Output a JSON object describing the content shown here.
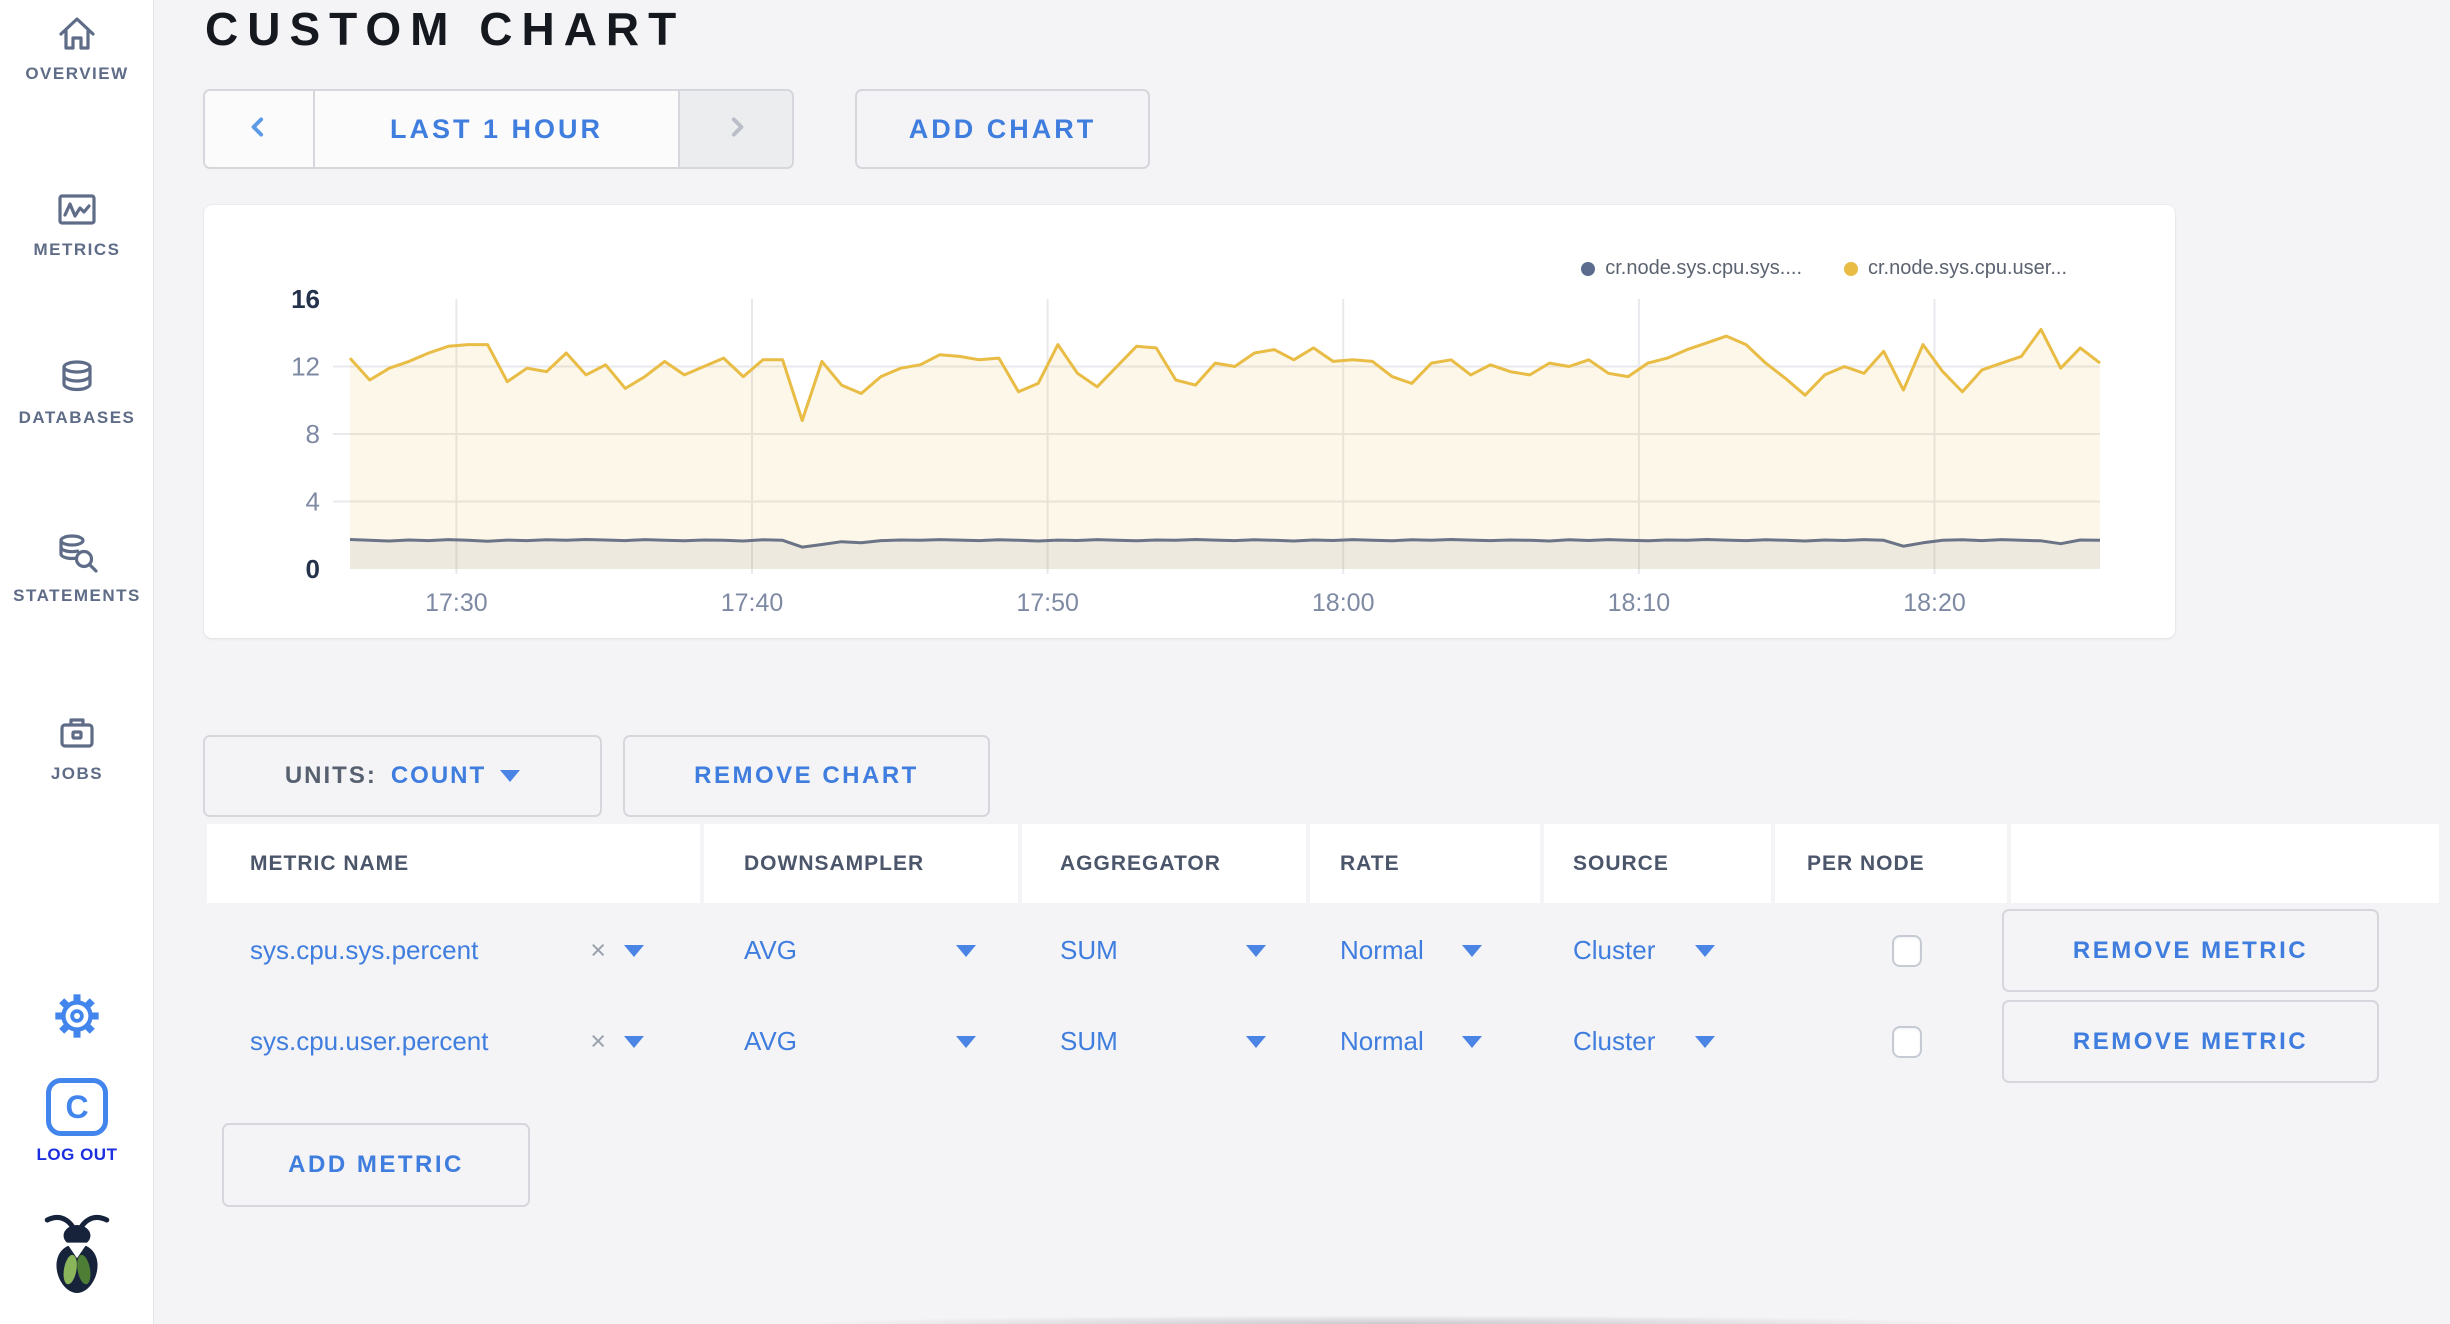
{
  "header": {
    "title": "CUSTOM CHART"
  },
  "toolbar": {
    "time_range_label": "LAST 1 HOUR",
    "add_chart_label": "ADD CHART"
  },
  "sidebar": {
    "items": [
      {
        "label": "OVERVIEW",
        "icon": "home-icon"
      },
      {
        "label": "METRICS",
        "icon": "metrics-icon"
      },
      {
        "label": "DATABASES",
        "icon": "databases-icon"
      },
      {
        "label": "STATEMENTS",
        "icon": "statements-icon"
      },
      {
        "label": "JOBS",
        "icon": "jobs-icon"
      }
    ],
    "logout_label": "LOG OUT",
    "logo_letter": "C"
  },
  "chart_controls": {
    "units_label": "UNITS:",
    "units_value": "COUNT",
    "remove_chart_label": "REMOVE CHART",
    "add_metric_label": "ADD METRIC"
  },
  "metrics_table": {
    "headers": [
      "METRIC NAME",
      "DOWNSAMPLER",
      "AGGREGATOR",
      "RATE",
      "SOURCE",
      "PER NODE",
      ""
    ],
    "rows": [
      {
        "metric_name": "sys.cpu.sys.percent",
        "clear": "×",
        "downsampler": "AVG",
        "aggregator": "SUM",
        "rate": "Normal",
        "source": "Cluster",
        "per_node_checked": false,
        "remove_label": "REMOVE METRIC"
      },
      {
        "metric_name": "sys.cpu.user.percent",
        "clear": "×",
        "downsampler": "AVG",
        "aggregator": "SUM",
        "rate": "Normal",
        "source": "Cluster",
        "per_node_checked": false,
        "remove_label": "REMOVE METRIC"
      }
    ]
  },
  "chart_data": {
    "type": "line",
    "title": "",
    "xlabel": "",
    "ylabel": "",
    "ylim": [
      0,
      16
    ],
    "y_ticks": [
      0,
      4,
      8,
      12,
      16
    ],
    "x_ticks": [
      "17:30",
      "17:40",
      "17:50",
      "18:00",
      "18:10",
      "18:20"
    ],
    "x_tick_minutes": [
      1050,
      1060,
      1070,
      1080,
      1090,
      1100
    ],
    "x_domain_minutes": [
      1046.4,
      1105.6
    ],
    "grid": true,
    "legend_position": "top-right",
    "colors": {
      "grid": "#E8E9EC",
      "axis_label": "#7E89A3",
      "axis_emphasis": "#24324B"
    },
    "series": [
      {
        "id": "sys",
        "name": "cr.node.sys.cpu.sys....",
        "color": "#6B7486",
        "fill": "rgba(107,116,134,0.10)",
        "values": [
          1.75,
          1.7,
          1.66,
          1.72,
          1.68,
          1.74,
          1.7,
          1.65,
          1.71,
          1.68,
          1.73,
          1.7,
          1.75,
          1.72,
          1.68,
          1.74,
          1.7,
          1.67,
          1.72,
          1.7,
          1.66,
          1.73,
          1.7,
          1.3,
          1.45,
          1.62,
          1.55,
          1.68,
          1.72,
          1.7,
          1.74,
          1.71,
          1.68,
          1.73,
          1.7,
          1.66,
          1.71,
          1.69,
          1.74,
          1.7,
          1.67,
          1.72,
          1.7,
          1.75,
          1.71,
          1.68,
          1.73,
          1.7,
          1.66,
          1.72,
          1.69,
          1.74,
          1.7,
          1.67,
          1.73,
          1.7,
          1.75,
          1.71,
          1.68,
          1.72,
          1.7,
          1.66,
          1.73,
          1.69,
          1.74,
          1.7,
          1.67,
          1.72,
          1.7,
          1.75,
          1.71,
          1.68,
          1.73,
          1.7,
          1.66,
          1.72,
          1.69,
          1.74,
          1.7,
          1.35,
          1.55,
          1.7,
          1.73,
          1.68,
          1.74,
          1.7,
          1.67,
          1.5,
          1.72,
          1.7
        ]
      },
      {
        "id": "user",
        "name": "cr.node.sys.cpu.user...",
        "color": "#E8BC45",
        "fill": "rgba(232,188,66,0.12)",
        "values": [
          12.5,
          11.2,
          11.9,
          12.3,
          12.8,
          13.2,
          13.3,
          13.3,
          11.1,
          11.9,
          11.7,
          12.8,
          11.5,
          12.1,
          10.7,
          11.4,
          12.3,
          11.5,
          12.0,
          12.5,
          11.4,
          12.4,
          12.4,
          8.8,
          12.3,
          10.9,
          10.4,
          11.4,
          11.9,
          12.1,
          12.7,
          12.6,
          12.4,
          12.5,
          10.5,
          11.0,
          13.3,
          11.6,
          10.8,
          12.0,
          13.2,
          13.1,
          11.2,
          10.9,
          12.2,
          12.0,
          12.8,
          13.0,
          12.4,
          13.1,
          12.3,
          12.4,
          12.3,
          11.4,
          11.0,
          12.2,
          12.4,
          11.5,
          12.1,
          11.7,
          11.5,
          12.2,
          12.0,
          12.4,
          11.6,
          11.4,
          12.2,
          12.5,
          13.0,
          13.4,
          13.8,
          13.3,
          12.2,
          11.3,
          10.3,
          11.5,
          12.0,
          11.6,
          12.9,
          10.6,
          13.3,
          11.7,
          10.5,
          11.8,
          12.2,
          12.6,
          14.2,
          11.9,
          13.1,
          12.2
        ]
      }
    ]
  }
}
